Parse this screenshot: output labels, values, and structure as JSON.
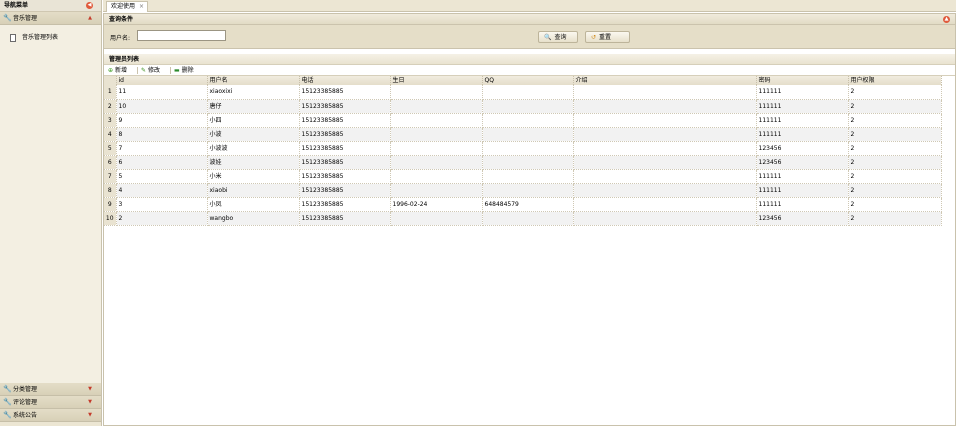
{
  "nav": {
    "title": "导航菜单",
    "sections": [
      {
        "label": "音乐管理",
        "expanded": true,
        "items": [
          "音乐管理列表"
        ]
      },
      {
        "label": "分类管理",
        "expanded": false
      },
      {
        "label": "评论管理",
        "expanded": false
      },
      {
        "label": "系统公告",
        "expanded": false
      }
    ]
  },
  "tabs": [
    {
      "label": "欢迎使用",
      "close": "×"
    }
  ],
  "query": {
    "title": "查询条件",
    "user_label": "用户名:",
    "user_value": "",
    "search_label": "查询",
    "reset_label": "重置"
  },
  "list": {
    "title": "管理员列表",
    "toolbar": {
      "add": "新增",
      "edit": "修改",
      "delete": "删除"
    },
    "columns": [
      "id",
      "用户名",
      "电话",
      "生日",
      "QQ",
      "介绍",
      "密码",
      "用户权限"
    ],
    "rows": [
      {
        "n": "1",
        "id": "11",
        "user": "xiaoxixi",
        "phone": "15123385885",
        "birth": "",
        "qq": "",
        "intro": "",
        "pwd": "111111",
        "role": "2"
      },
      {
        "n": "2",
        "id": "10",
        "user": "唐仔",
        "phone": "15123385885",
        "birth": "",
        "qq": "",
        "intro": "",
        "pwd": "111111",
        "role": "2"
      },
      {
        "n": "3",
        "id": "9",
        "user": "小四",
        "phone": "15123385885",
        "birth": "",
        "qq": "",
        "intro": "",
        "pwd": "111111",
        "role": "2"
      },
      {
        "n": "4",
        "id": "8",
        "user": "小波",
        "phone": "15123385885",
        "birth": "",
        "qq": "",
        "intro": "",
        "pwd": "111111",
        "role": "2"
      },
      {
        "n": "5",
        "id": "7",
        "user": "小波波",
        "phone": "15123385885",
        "birth": "",
        "qq": "",
        "intro": "",
        "pwd": "123456",
        "role": "2"
      },
      {
        "n": "6",
        "id": "6",
        "user": "波娃",
        "phone": "15123385885",
        "birth": "",
        "qq": "",
        "intro": "",
        "pwd": "123456",
        "role": "2"
      },
      {
        "n": "7",
        "id": "5",
        "user": "小米",
        "phone": "15123385885",
        "birth": "",
        "qq": "",
        "intro": "",
        "pwd": "111111",
        "role": "2"
      },
      {
        "n": "8",
        "id": "4",
        "user": "xiaobi",
        "phone": "15123385885",
        "birth": "",
        "qq": "",
        "intro": "",
        "pwd": "111111",
        "role": "2"
      },
      {
        "n": "9",
        "id": "3",
        "user": "小凤",
        "phone": "15123385885",
        "birth": "1996-02-24",
        "qq": "648484579",
        "intro": "",
        "pwd": "111111",
        "role": "2"
      },
      {
        "n": "10",
        "id": "2",
        "user": "wangbo",
        "phone": "15123385885",
        "birth": "",
        "qq": "",
        "intro": "",
        "pwd": "123456",
        "role": "2"
      }
    ]
  },
  "colors": {
    "accent_red": "#e05a3c",
    "panel_bg": "#e5dec8",
    "nav_bg": "#f3efe2"
  }
}
